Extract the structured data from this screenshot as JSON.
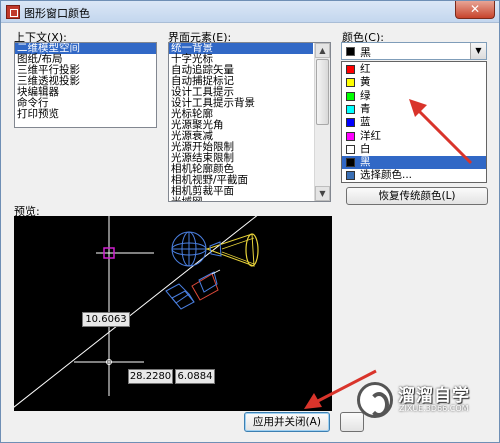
{
  "window": {
    "title": "图形窗口颜色",
    "close_glyph": "✕"
  },
  "context": {
    "label": "上下文(X):",
    "items": [
      "二维模型空间",
      "图纸/布局",
      "三维平行投影",
      "三维透视投影",
      "块编辑器",
      "命令行",
      "打印预览"
    ],
    "selected_index": 0
  },
  "elements": {
    "label": "界面元素(E):",
    "items": [
      "统一背景",
      "十字光标",
      "自动追踪矢量",
      "自动捕捉标记",
      "设计工具提示",
      "设计工具提示背景",
      "光标轮廓",
      "光源聚光角",
      "光源衰减",
      "光源开始限制",
      "光源结束限制",
      "相机轮廓颜色",
      "相机视野/平截面",
      "相机剪裁平面",
      "光域网"
    ],
    "selected_index": 0
  },
  "color": {
    "label": "颜色(C):",
    "current": "黑",
    "current_swatch": "#000000",
    "options": [
      {
        "label": "红",
        "swatch": "#ff0000"
      },
      {
        "label": "黄",
        "swatch": "#ffff00"
      },
      {
        "label": "绿",
        "swatch": "#00ff00"
      },
      {
        "label": "青",
        "swatch": "#00ffff"
      },
      {
        "label": "蓝",
        "swatch": "#0000ff"
      },
      {
        "label": "洋红",
        "swatch": "#ff00ff"
      },
      {
        "label": "白",
        "swatch": "#ffffff"
      },
      {
        "label": "黑",
        "swatch": "#000000"
      },
      {
        "label": "选择颜色...",
        "swatch": "#3a6fb5"
      }
    ],
    "selected_index": 7
  },
  "buttons": {
    "restore_classic": "恢复传统颜色(L)",
    "apply_close": "应用并关闭(A)"
  },
  "preview": {
    "label": "预览:",
    "coord_primary": "10.6063",
    "coord_x": "28.2280",
    "coord_y": "6.0884"
  },
  "watermark": {
    "title": "溜溜自学",
    "url": "ZIXUE.3D66.COM"
  },
  "accent": {
    "annotation_arrow": "#d9342b",
    "selection": "#3168c6"
  }
}
